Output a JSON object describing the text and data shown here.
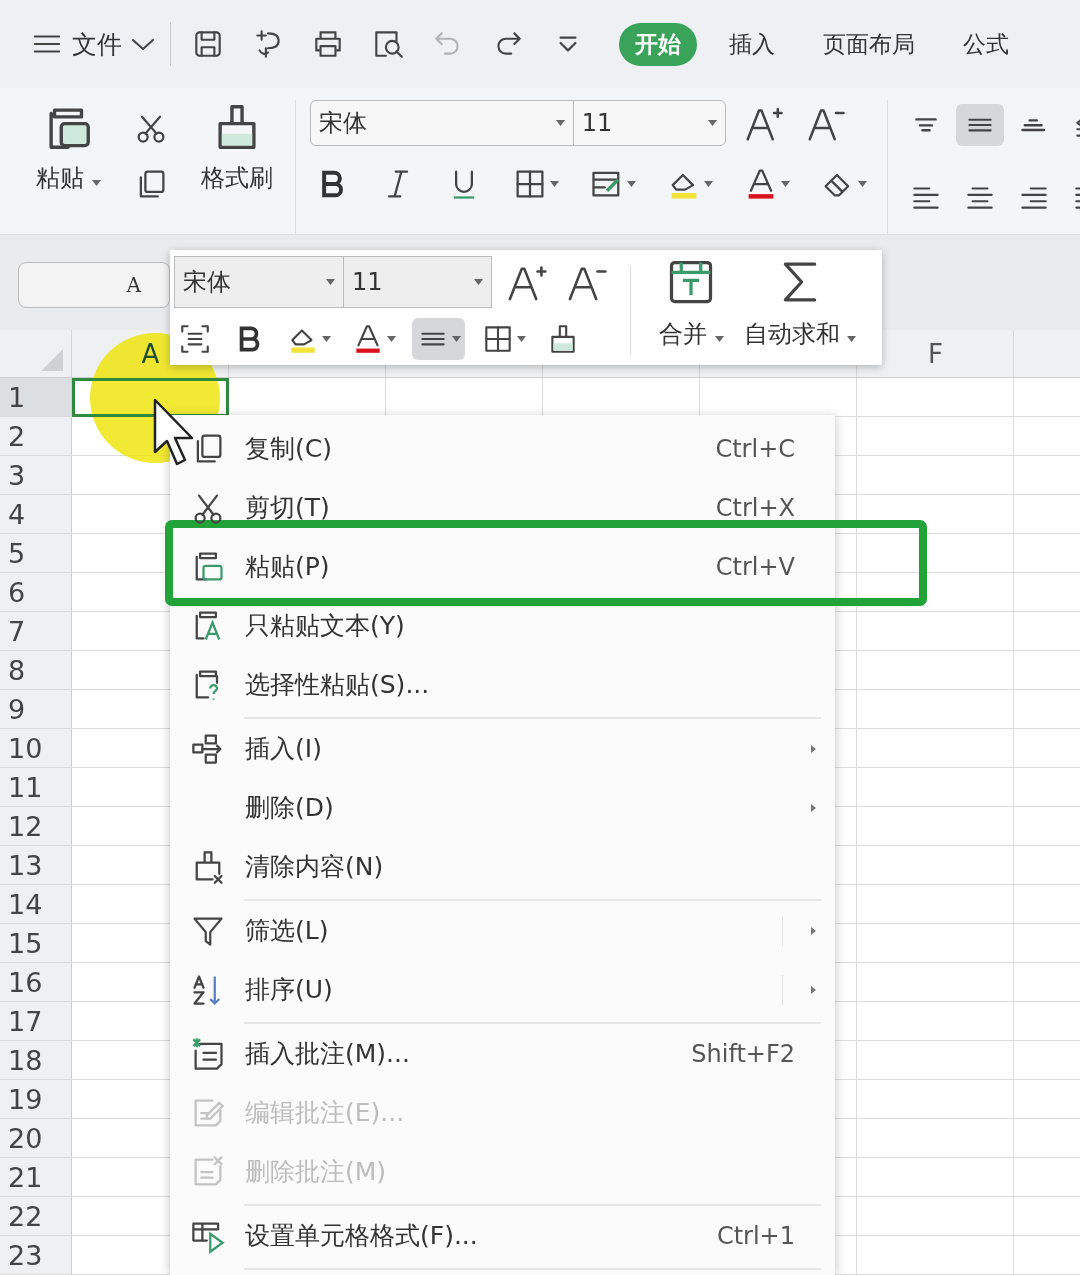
{
  "file_menu": {
    "label": "文件"
  },
  "quick_access": [
    {
      "kind": "save",
      "disabled": false
    },
    {
      "kind": "convert",
      "disabled": false
    },
    {
      "kind": "print",
      "disabled": false
    },
    {
      "kind": "preview",
      "disabled": false
    },
    {
      "kind": "undo",
      "disabled": true
    },
    {
      "kind": "redo",
      "disabled": false
    },
    {
      "kind": "more",
      "disabled": false
    }
  ],
  "tabs": [
    {
      "label": "开始",
      "selected": true
    },
    {
      "label": "插入",
      "selected": false
    },
    {
      "label": "页面布局",
      "selected": false
    },
    {
      "label": "公式",
      "selected": false
    }
  ],
  "ribbon": {
    "paste_label": "粘贴",
    "painter_label": "格式刷",
    "font_name": "宋体",
    "font_size": "11",
    "align_buttons": [
      {
        "kind": "top",
        "selected": false
      },
      {
        "kind": "middle",
        "selected": true
      },
      {
        "kind": "bottom",
        "selected": false
      },
      {
        "kind": "indent",
        "selected": false
      },
      {
        "kind": "left",
        "selected": false
      },
      {
        "kind": "center",
        "selected": false
      },
      {
        "kind": "right",
        "selected": false
      },
      {
        "kind": "justify",
        "selected": false
      }
    ]
  },
  "name_box": {
    "value": "A"
  },
  "sheet": {
    "columns": [
      {
        "label": "A",
        "selected": true
      },
      {
        "selected": false
      },
      {
        "selected": false
      },
      {
        "selected": false
      },
      {
        "selected": false
      },
      {
        "label": "F",
        "selected": false
      },
      {
        "selected": false
      }
    ],
    "rows": [
      {
        "label": "1",
        "selected": true
      },
      {
        "label": "2",
        "selected": false
      },
      {
        "label": "3",
        "selected": false
      },
      {
        "label": "4",
        "selected": false
      },
      {
        "label": "5",
        "selected": false
      },
      {
        "label": "6",
        "selected": false
      },
      {
        "label": "7",
        "selected": false
      },
      {
        "label": "8",
        "selected": false
      },
      {
        "label": "9",
        "selected": false
      },
      {
        "label": "10",
        "selected": false
      },
      {
        "label": "11",
        "selected": false
      },
      {
        "label": "12",
        "selected": false
      },
      {
        "label": "13",
        "selected": false
      },
      {
        "label": "14",
        "selected": false
      },
      {
        "label": "15",
        "selected": false
      },
      {
        "label": "16",
        "selected": false
      },
      {
        "label": "17",
        "selected": false
      },
      {
        "label": "18",
        "selected": false
      },
      {
        "label": "19",
        "selected": false
      },
      {
        "label": "20",
        "selected": false
      },
      {
        "label": "21",
        "selected": false
      },
      {
        "label": "22",
        "selected": false
      },
      {
        "label": "23",
        "selected": false
      }
    ]
  },
  "mini_toolbar": {
    "font_name": "宋体",
    "font_size": "11",
    "align_selected": true,
    "merge_label": "合并",
    "autosum_label": "自动求和"
  },
  "context_menu": {
    "items": [
      {
        "kind": "copy",
        "label": "复制(C)",
        "shortcut": "Ctrl+C",
        "submenu": false,
        "split": false,
        "disabled": false,
        "highlighted": false,
        "separator_after": false
      },
      {
        "kind": "cut",
        "label": "剪切(T)",
        "shortcut": "Ctrl+X",
        "submenu": false,
        "split": false,
        "disabled": false,
        "highlighted": false,
        "separator_after": false
      },
      {
        "kind": "paste",
        "label": "粘贴(P)",
        "shortcut": "Ctrl+V",
        "submenu": false,
        "split": false,
        "disabled": false,
        "highlighted": true,
        "separator_after": false
      },
      {
        "kind": "paste-text",
        "label": "只粘贴文本(Y)",
        "submenu": false,
        "split": false,
        "disabled": false,
        "highlighted": false,
        "separator_after": false
      },
      {
        "kind": "paste-special",
        "label": "选择性粘贴(S)...",
        "submenu": false,
        "split": false,
        "disabled": false,
        "highlighted": false,
        "separator_after": true
      },
      {
        "kind": "insert",
        "label": "插入(I)",
        "submenu": true,
        "split": false,
        "disabled": false,
        "highlighted": false,
        "separator_after": false
      },
      {
        "kind": "none",
        "label": "删除(D)",
        "submenu": true,
        "split": false,
        "disabled": false,
        "highlighted": false,
        "separator_after": false
      },
      {
        "kind": "clear",
        "label": "清除内容(N)",
        "submenu": false,
        "split": false,
        "disabled": false,
        "highlighted": false,
        "separator_after": true
      },
      {
        "kind": "filter",
        "label": "筛选(L)",
        "submenu": true,
        "split": true,
        "disabled": false,
        "highlighted": false,
        "separator_after": false
      },
      {
        "kind": "sort",
        "label": "排序(U)",
        "submenu": true,
        "split": true,
        "disabled": false,
        "highlighted": false,
        "separator_after": true
      },
      {
        "kind": "comment-add",
        "label": "插入批注(M)...",
        "shortcut": "Shift+F2",
        "submenu": false,
        "split": false,
        "disabled": false,
        "highlighted": false,
        "separator_after": false
      },
      {
        "kind": "comment-edit",
        "label": "编辑批注(E)...",
        "submenu": false,
        "split": false,
        "disabled": true,
        "highlighted": false,
        "separator_after": false
      },
      {
        "kind": "comment-delete",
        "label": "删除批注(M)",
        "submenu": false,
        "split": false,
        "disabled": true,
        "highlighted": false,
        "separator_after": true
      },
      {
        "kind": "format-cells",
        "label": "设置单元格格式(F)...",
        "shortcut": "Ctrl+1",
        "submenu": false,
        "split": false,
        "disabled": false,
        "highlighted": false,
        "separator_after": true
      }
    ]
  }
}
